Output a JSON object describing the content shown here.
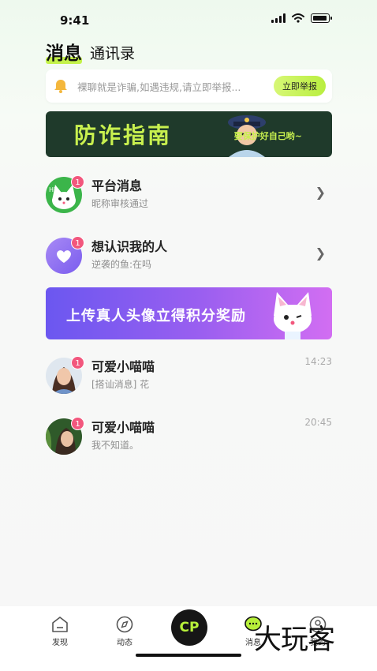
{
  "status_bar": {
    "time": "9:41"
  },
  "tabs": {
    "active": "消息",
    "other": "通讯录"
  },
  "notice": {
    "text": "裸聊就是诈骗,如遇违规,请立即举报...",
    "button": "立即举报"
  },
  "guide_banner": {
    "title": "防诈指南",
    "subtitle": "要保护好自己哟~"
  },
  "conversations": [
    {
      "title": "平台消息",
      "subtitle": "昵称审核通过",
      "badge": "1"
    },
    {
      "title": "想认识我的人",
      "subtitle": "逆袭的鱼:在吗",
      "badge": "1"
    }
  ],
  "upload_banner": {
    "text": "上传真人头像立得积分奖励"
  },
  "chats": [
    {
      "name": "可爱小喵喵",
      "message": "[搭讪消息] 花",
      "time": "14:23",
      "badge": "1"
    },
    {
      "name": "可爱小喵喵",
      "message": "我不知道。",
      "time": "20:45",
      "badge": "1"
    }
  ],
  "bottom_nav": {
    "discover": "发现",
    "moments": "动态",
    "cp": "CP",
    "messages": "消息",
    "mine": "我的"
  },
  "watermark": "大玩客",
  "colors": {
    "accent": "#c4f24a",
    "badge": "#f2577d",
    "banner_dark": "#1f3a2b"
  }
}
